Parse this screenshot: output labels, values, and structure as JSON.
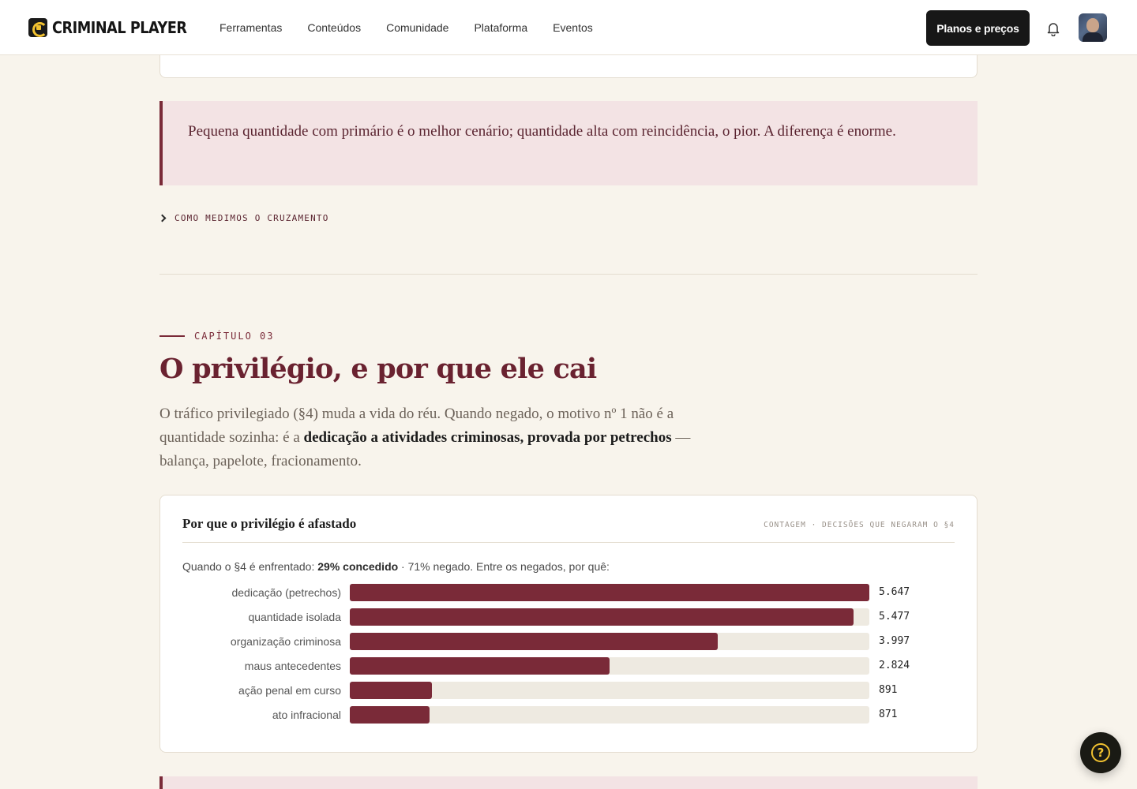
{
  "header": {
    "logo_text": "CRIMINAL PLAYER",
    "nav": [
      "Ferramentas",
      "Conteúdos",
      "Comunidade",
      "Plataforma",
      "Eventos"
    ],
    "plans_button": "Planos e preços",
    "icons": [
      "bell-icon",
      "avatar"
    ]
  },
  "callout": {
    "text": "Pequena quantidade com primário é o melhor cenário; quantidade alta com reincidência, o pior. A diferença é enorme."
  },
  "method_toggle": "COMO MEDIMOS O CRUZAMENTO",
  "chapter": {
    "label": "CAPÍTULO 03",
    "title": "O privilégio, e por que ele cai",
    "lead_pre": "O tráfico privilegiado (§4) muda a vida do réu. Quando negado, o motivo nº 1 não é a quantidade sozinha: é a ",
    "lead_bold": "dedicação a atividades criminosas, provada por petrechos",
    "lead_post": " — balança, papelote, fracionamento."
  },
  "chart_card": {
    "title": "Por que o privilégio é afastado",
    "meta": "CONTAGEM · DECISÕES QUE NEGARAM O §4",
    "sub_pre": "Quando o §4 é enfrentado: ",
    "sub_bold": "29% concedido",
    "sub_post": " · 71% negado. Entre os negados, por quê:"
  },
  "chart_data": {
    "type": "bar",
    "orientation": "horizontal",
    "title": "Por que o privilégio é afastado",
    "categories": [
      "dedicação (petrechos)",
      "quantidade isolada",
      "organização criminosa",
      "maus antecedentes",
      "ação penal em curso",
      "ato infracional"
    ],
    "values": [
      5647,
      5477,
      3997,
      2824,
      891,
      871
    ],
    "value_labels": [
      "5.647",
      "5.477",
      "3.997",
      "2.824",
      "891",
      "871"
    ],
    "xlim": [
      0,
      5647
    ],
    "colors": {
      "bar": "#7a2a38",
      "track": "#eeeae1"
    }
  },
  "colors": {
    "accent": "#7a2a38",
    "background": "#f8f4ec",
    "callout_bg": "#f3e3e4"
  }
}
